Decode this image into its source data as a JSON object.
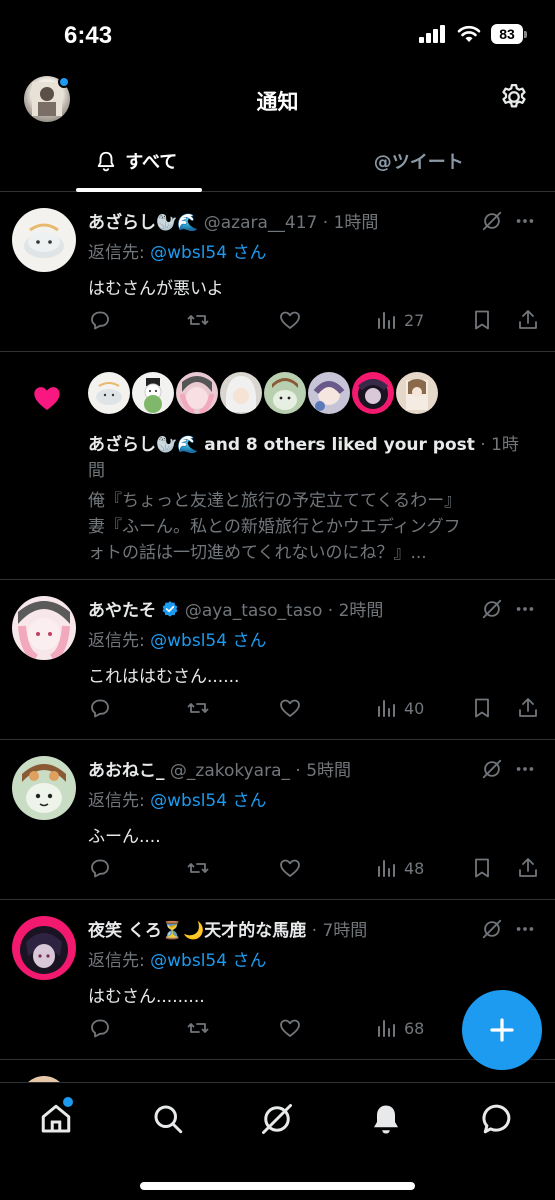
{
  "status_bar": {
    "time": "6:43",
    "battery": "83"
  },
  "header": {
    "title": "通知"
  },
  "tabs": {
    "all": "すべて",
    "mentions": "@ツイート"
  },
  "notifications": [
    {
      "name": "あざらし🦭🌊",
      "handle": "@azara__417",
      "time": "· 1時間",
      "reply_label": "返信先: ",
      "reply_handle": "@wbsl54 さん",
      "text": "はむさんが悪いよ",
      "views": "27"
    },
    {
      "like_names": "あざらし🦭🌊 and 8 others liked your post",
      "like_time": " · 1時間",
      "preview_line1": "俺『ちょっと友達と旅行の予定立ててくるわー』",
      "preview_line2": "妻『ふーん。私との新婚旅行とかウエディングフ",
      "preview_line3": "ォトの話は一切進めてくれないのにね？』..."
    },
    {
      "name": "あやたそ",
      "handle": "@aya_taso_taso",
      "time": "· 2時間",
      "reply_label": "返信先: ",
      "reply_handle": "@wbsl54 さん",
      "text": "これははむさん......",
      "views": "40"
    },
    {
      "name": "あおねこ_",
      "handle": "@_zakokyara_",
      "time": "· 5時間",
      "reply_label": "返信先: ",
      "reply_handle": "@wbsl54 さん",
      "text": "ふーん....",
      "views": "48"
    },
    {
      "name": "夜笑 くろ⏳🌙天才的な馬鹿",
      "handle": "",
      "time": "· 7時間",
      "reply_label": "返信先: ",
      "reply_handle": "@wbsl54 さん",
      "text": "はむさん.........",
      "views": "68"
    }
  ],
  "colors": {
    "accent": "#1d9bf0",
    "like": "#f91880",
    "muted": "#71767b",
    "border": "#2f3336"
  },
  "icons": [
    "signal-icon",
    "wifi-icon",
    "battery-icon",
    "gear-icon",
    "bell-icon",
    "reply-icon",
    "retweet-icon",
    "heart-icon",
    "views-icon",
    "bookmark-icon",
    "share-icon",
    "grok-icon",
    "more-icon",
    "compose-icon",
    "home-icon",
    "search-icon",
    "messages-icon",
    "verified-icon"
  ]
}
